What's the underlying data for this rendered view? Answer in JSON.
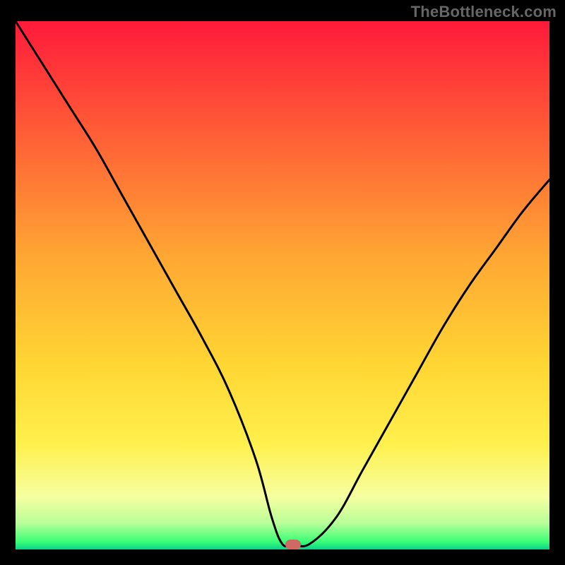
{
  "watermark": "TheBottleneck.com",
  "chart_data": {
    "type": "line",
    "title": "",
    "xlabel": "",
    "ylabel": "",
    "xlim": [
      0,
      100
    ],
    "ylim": [
      0,
      100
    ],
    "grid": false,
    "legend": false,
    "background_gradient": {
      "stops": [
        {
          "offset": 0.0,
          "color": "#ff1a3a"
        },
        {
          "offset": 0.2,
          "color": "#ff5a36"
        },
        {
          "offset": 0.45,
          "color": "#ffa833"
        },
        {
          "offset": 0.65,
          "color": "#ffd633"
        },
        {
          "offset": 0.8,
          "color": "#fff04d"
        },
        {
          "offset": 0.9,
          "color": "#f6ffa0"
        },
        {
          "offset": 0.95,
          "color": "#b9ff99"
        },
        {
          "offset": 0.985,
          "color": "#3bff77"
        },
        {
          "offset": 1.0,
          "color": "#0ad18e"
        }
      ]
    },
    "series": [
      {
        "name": "bottleneck-curve",
        "x": [
          0,
          5,
          10,
          15,
          20,
          25,
          30,
          35,
          40,
          45,
          48,
          50,
          52,
          55,
          60,
          65,
          70,
          75,
          80,
          85,
          90,
          95,
          100
        ],
        "y": [
          100,
          92,
          84,
          76,
          67,
          58,
          49,
          40,
          30,
          17,
          6,
          1,
          1,
          1,
          6,
          15,
          24,
          33,
          42,
          50,
          57,
          64,
          70
        ],
        "stroke": "#000000",
        "stroke_width": 2
      }
    ],
    "flat_segment": {
      "x_start": 48,
      "x_end": 55,
      "y": 1
    },
    "marker": {
      "x": 52,
      "y": 1,
      "color": "#cf6a63",
      "shape": "rounded-rect"
    }
  }
}
